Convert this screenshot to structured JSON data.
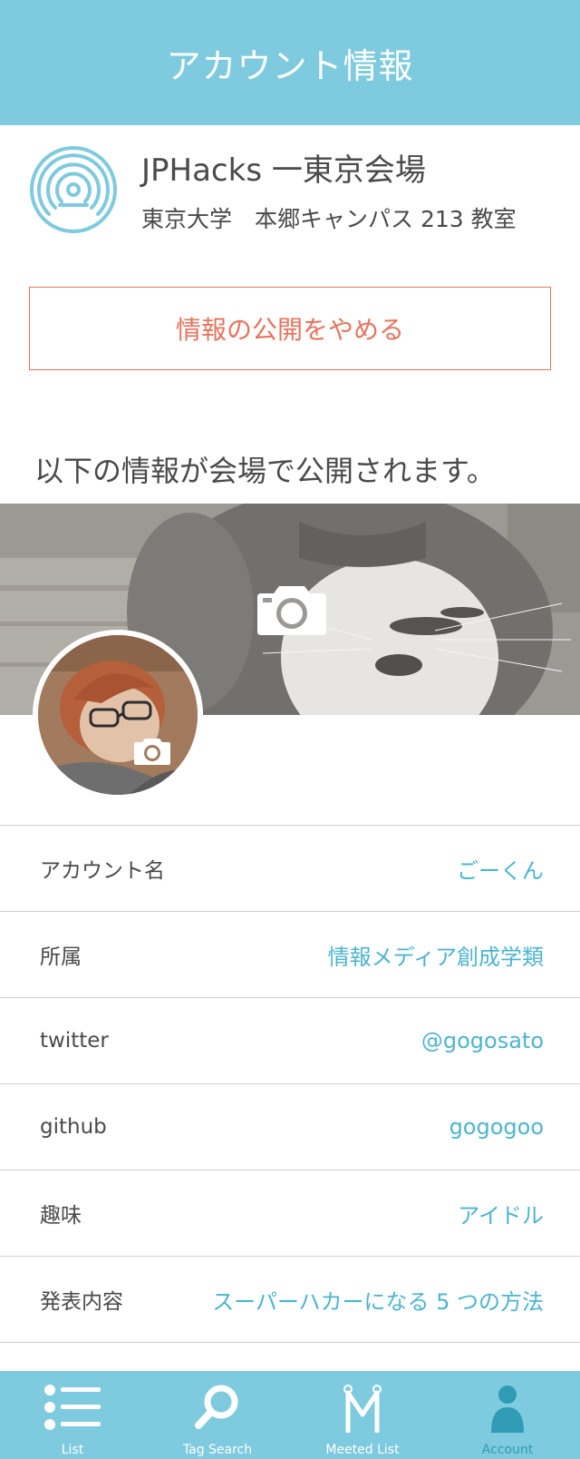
{
  "header": {
    "title": "アカウント情報"
  },
  "venue": {
    "name": "JPHacks 一東京会場",
    "place": "東京大学　本郷キャンパス 213 教室"
  },
  "stop_button": {
    "label": "情報の公開をやめる"
  },
  "notice": "以下の情報が会場で公開されます。",
  "profile": {
    "cover_icon": "camera-icon",
    "avatar_icon": "camera-icon"
  },
  "info": [
    {
      "label": "アカウント名",
      "value": "ごーくん"
    },
    {
      "label": "所属",
      "value": "情報メディア創成学類"
    },
    {
      "label": "twitter",
      "value": "@gogosato"
    },
    {
      "label": "github",
      "value": "gogogoo"
    },
    {
      "label": "趣味",
      "value": "アイドル"
    },
    {
      "label": "発表内容",
      "value": "スーパーハカーになる 5 つの方法"
    }
  ],
  "tabs": [
    {
      "label": "List",
      "icon": "list-icon",
      "active": false
    },
    {
      "label": "Tag Search",
      "icon": "search-icon",
      "active": false
    },
    {
      "label": "Meeted List",
      "icon": "meeted-icon",
      "active": false
    },
    {
      "label": "Account",
      "icon": "person-icon",
      "active": true
    }
  ],
  "colors": {
    "primary": "#7ecade",
    "accent_text": "#4cb5cf",
    "danger": "#e8735d",
    "active_tab": "#2f9bb5"
  }
}
